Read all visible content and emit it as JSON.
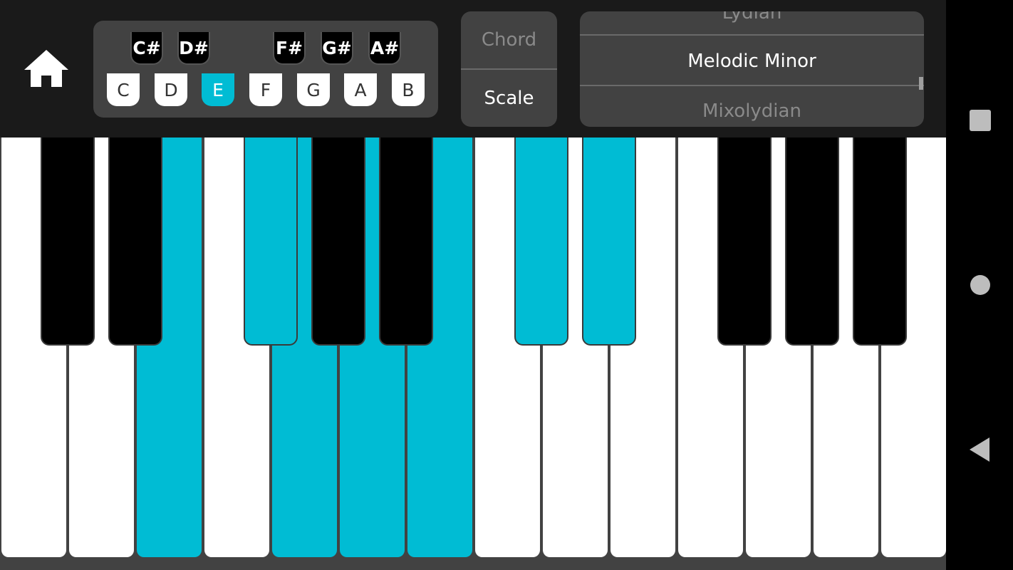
{
  "top_bar": {
    "home_icon": "home-icon",
    "key_selector": {
      "black_keys": [
        "C#",
        "D#",
        "F#",
        "G#",
        "A#"
      ],
      "white_keys": [
        "C",
        "D",
        "E",
        "F",
        "G",
        "A",
        "B"
      ],
      "selected": "E"
    },
    "mode_selector": {
      "options": [
        "Chord",
        "Scale"
      ],
      "selected": "Scale"
    },
    "scale_list": {
      "items": [
        "Lydian",
        "Melodic Minor",
        "Mixolydian"
      ],
      "selected": "Melodic Minor"
    }
  },
  "piano": {
    "white_keys": [
      "C",
      "D",
      "E",
      "F",
      "G",
      "A",
      "B",
      "C",
      "D",
      "E",
      "F",
      "G",
      "A",
      "B"
    ],
    "black_keys": [
      "C#",
      "D#",
      "F#",
      "G#",
      "A#",
      "C#",
      "D#",
      "F#",
      "G#",
      "A#"
    ],
    "highlighted_white": [
      2,
      4,
      5,
      6
    ],
    "highlighted_black": [
      2,
      5,
      6
    ],
    "highlight_color": "#00bcd4"
  },
  "nav_bar": {
    "icons": [
      "recents-icon",
      "home-circle-icon",
      "back-icon"
    ]
  },
  "colors": {
    "accent": "#00bcd4",
    "panel": "#424242",
    "topbar": "#1a1a1a"
  }
}
